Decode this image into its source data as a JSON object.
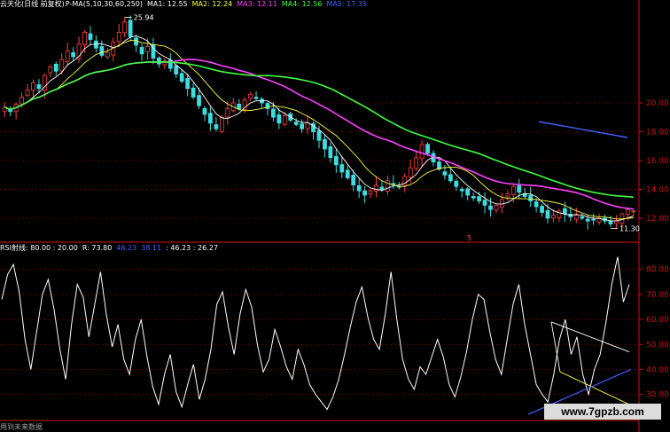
{
  "colors": {
    "up": "#ff4040",
    "down": "#3cdce0",
    "ma5": "#ffffff",
    "ma10": "#ffff40",
    "ma30": "#ff40ff",
    "ma60": "#40ff40",
    "ma250": "#4060ff",
    "rsi": "#ffffff",
    "axis": "#d01010",
    "axis_label": "#d01010",
    "grid": "#800000"
  },
  "header_main": {
    "stock_label": "云天化(日线 前复权)",
    "indicator_label": "P-MA(5,10,30,60,250)",
    "ma1": "MA1: 12.55",
    "ma2": "MA2: 12.24",
    "ma3": "MA3: 12.11",
    "ma4": "MA4: 12.56",
    "ma5": "MA5: 17.35"
  },
  "header_rsi": {
    "name": "RSI射线",
    "params": ": 80.00 : 20.00",
    "r_value": "R: 73.80",
    "v1": "46.23",
    "v2": "38.11",
    "v3": ": 46.23 : 26.27"
  },
  "annotations": {
    "high_label": "25.94",
    "low_label": "11.30",
    "marker": "5"
  },
  "footer_text": "用到未来数据",
  "watermark": "www.7gpzb.com",
  "chart_data": [
    {
      "type": "candlestick",
      "ylabel_ticks": [
        "12.00",
        "14.00",
        "16.00",
        "18.00",
        "20.00"
      ],
      "ylim": [
        10.4,
        26.4
      ],
      "close": [
        19.7,
        19.4,
        19.9,
        20.4,
        20.9,
        21.4,
        21.0,
        21.9,
        22.5,
        22.2,
        23.0,
        23.6,
        23.2,
        24.1,
        24.9,
        24.4,
        23.8,
        23.3,
        23.5,
        24.2,
        24.9,
        25.6,
        24.6,
        24.0,
        23.4,
        23.9,
        23.1,
        22.7,
        22.9,
        22.4,
        22.0,
        21.5,
        21.0,
        20.4,
        19.8,
        19.2,
        18.6,
        18.2,
        19.0,
        19.6,
        20.0,
        19.6,
        20.2,
        20.6,
        20.3,
        20.0,
        19.6,
        19.0,
        18.6,
        19.1,
        18.8,
        18.5,
        18.2,
        18.6,
        18.0,
        17.4,
        16.8,
        16.2,
        15.7,
        15.2,
        14.8,
        14.3,
        13.9,
        13.6,
        13.9,
        14.3,
        14.0,
        14.6,
        14.4,
        14.2,
        14.9,
        15.5,
        16.2,
        17.1,
        16.5,
        15.9,
        15.4,
        15.0,
        14.6,
        14.2,
        13.9,
        13.6,
        13.4,
        13.2,
        12.9,
        12.6,
        12.9,
        13.3,
        13.7,
        14.2,
        13.8,
        13.5,
        13.2,
        12.8,
        12.4,
        12.0,
        12.2,
        12.5,
        12.3,
        12.1,
        12.2,
        12.0,
        11.8,
        11.9,
        12.0,
        11.8,
        11.6,
        11.8,
        12.3,
        12.6,
        12.5
      ],
      "high_value": 25.94,
      "low_value": 11.3,
      "series": [
        "MA5",
        "MA10",
        "MA30",
        "MA60",
        "MA250"
      ]
    },
    {
      "type": "line",
      "name": "RSI",
      "ylabel_ticks": [
        "30.00",
        "40.00",
        "50.00",
        "60.00",
        "70.00",
        "80.00"
      ],
      "ylim": [
        21,
        87
      ],
      "values": [
        68,
        78,
        82,
        71,
        52,
        40,
        55,
        70,
        76,
        64,
        48,
        36,
        58,
        74,
        69,
        53,
        66,
        79,
        62,
        49,
        58,
        44,
        38,
        52,
        60,
        45,
        33,
        26,
        38,
        46,
        31,
        25,
        34,
        42,
        28,
        36,
        48,
        66,
        71,
        57,
        46,
        62,
        72,
        65,
        50,
        39,
        44,
        56,
        49,
        41,
        36,
        48,
        42,
        34,
        30,
        27,
        24,
        29,
        36,
        46,
        57,
        67,
        73,
        61,
        52,
        48,
        62,
        79,
        60,
        44,
        36,
        32,
        41,
        38,
        45,
        52,
        45,
        34,
        29,
        37,
        47,
        60,
        70,
        68,
        55,
        44,
        38,
        52,
        66,
        74,
        58,
        46,
        34,
        30,
        27,
        38,
        52,
        60,
        46,
        53,
        38,
        30,
        40,
        46,
        59,
        74,
        85,
        67,
        74
      ]
    }
  ]
}
